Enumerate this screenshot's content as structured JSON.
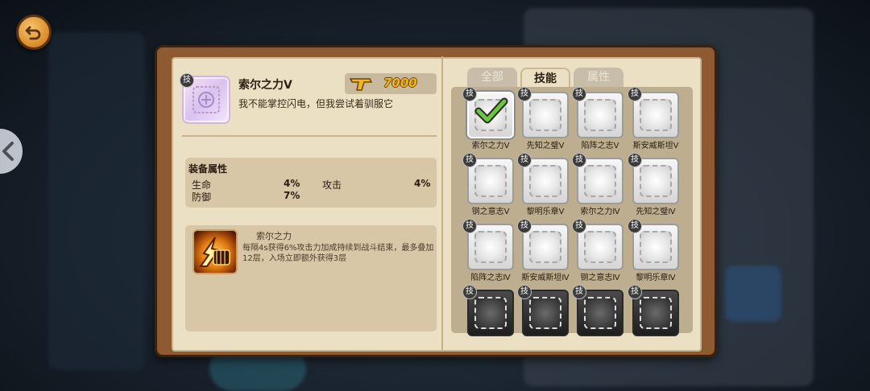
{
  "item": {
    "badge": "技",
    "title": "索尔之力Ⅴ",
    "description": "我不能掌控闪电，但我尝试着驯服它",
    "price": "7000"
  },
  "stats": {
    "header": "装备属性",
    "rows": [
      {
        "label": "生命",
        "value": "4%"
      },
      {
        "label": "攻击",
        "value": "4%"
      },
      {
        "label": "防御",
        "value": "7%"
      }
    ]
  },
  "skill": {
    "name": "索尔之力",
    "description": "每隔4s获得6%攻击力加成持续到战斗结束，最多叠加12层，入场立即额外获得3层"
  },
  "tabs": [
    {
      "label": "全部",
      "active": false
    },
    {
      "label": "技能",
      "active": true
    },
    {
      "label": "属性",
      "active": false
    }
  ],
  "grid": [
    {
      "label": "索尔之力Ⅴ",
      "badge": "技",
      "selected": true,
      "dark": false
    },
    {
      "label": "先知之璧Ⅴ",
      "badge": "技",
      "selected": false,
      "dark": false
    },
    {
      "label": "陷阵之志Ⅴ",
      "badge": "技",
      "selected": false,
      "dark": false
    },
    {
      "label": "斯安威斯坦Ⅴ",
      "badge": "技",
      "selected": false,
      "dark": false
    },
    {
      "label": "钢之意志Ⅴ",
      "badge": "技",
      "selected": false,
      "dark": false
    },
    {
      "label": "黎明乐章Ⅴ",
      "badge": "技",
      "selected": false,
      "dark": false
    },
    {
      "label": "索尔之力Ⅳ",
      "badge": "技",
      "selected": false,
      "dark": false
    },
    {
      "label": "先知之璧Ⅳ",
      "badge": "技",
      "selected": false,
      "dark": false
    },
    {
      "label": "陷阵之志Ⅳ",
      "badge": "技",
      "selected": false,
      "dark": false
    },
    {
      "label": "斯安威斯坦Ⅳ",
      "badge": "技",
      "selected": false,
      "dark": false
    },
    {
      "label": "钢之意志Ⅳ",
      "badge": "技",
      "selected": false,
      "dark": false
    },
    {
      "label": "黎明乐章Ⅳ",
      "badge": "技",
      "selected": false,
      "dark": false
    },
    {
      "label": "",
      "badge": "技",
      "selected": false,
      "dark": true
    },
    {
      "label": "",
      "badge": "技",
      "selected": false,
      "dark": true
    },
    {
      "label": "",
      "badge": "技",
      "selected": false,
      "dark": true
    },
    {
      "label": "",
      "badge": "技",
      "selected": false,
      "dark": true
    }
  ],
  "icons": {
    "back": "back-arrow-icon",
    "price": "gun-icon",
    "check": "checkmark-icon",
    "side": "chevron-left-icon"
  },
  "colors": {
    "frame": "#8e5a31",
    "parchment": "#ece0c4",
    "price": "#f3b61c",
    "check": "#6cc83a"
  }
}
